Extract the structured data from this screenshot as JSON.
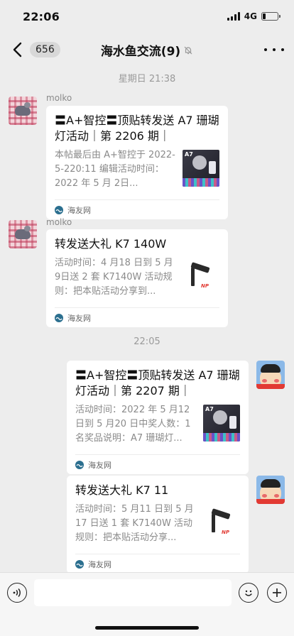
{
  "status_bar": {
    "time": "22:06",
    "network": "4G",
    "battery_level": 0.2
  },
  "nav": {
    "unread_count": "656",
    "title": "海水鱼交流(9)"
  },
  "timestamps": [
    "星期日 21:38",
    "22:05"
  ],
  "messages": [
    {
      "sender": "molko",
      "title": "〓A+智控〓顶贴转发送 A7 珊瑚灯活动｜第 2206 期｜",
      "desc": "本帖最后由 A+智控于 2022-5-220:11 编辑活动时间：2022 年 5 月 2日...",
      "thumb_label": "A7",
      "source": "海友网"
    },
    {
      "sender": "molko",
      "title": "转发送大礼 K7 140W",
      "desc": "活动时间：4 月18 日到 5 月 9日送 2 套 K7140W 活动规则：把本贴活动分享到...",
      "thumb_label": "NP",
      "source": "海友网"
    },
    {
      "sender": "",
      "title": "〓A+智控〓顶贴转发送 A7 珊瑚灯活动｜第 2207 期｜",
      "desc": "活动时间：2022 年 5 月12 日到 5 月20 日中奖人数：1 名奖品说明：A7 珊瑚灯...",
      "thumb_label": "A7",
      "source": "海友网"
    },
    {
      "sender": "",
      "title": "转发送大礼 K7 11",
      "desc": "活动时间：5 月11 日到 5 月17 日送 1 套 K7140W 活动规则：把本贴活动分享...",
      "thumb_label": "NP",
      "source": "海友网"
    }
  ],
  "input": {
    "value": "",
    "placeholder": ""
  },
  "icons": {
    "back": "chevron-left-icon",
    "mute": "bell-off-icon",
    "more": "more-dots-icon",
    "voice": "voice-icon",
    "emoji": "emoji-icon",
    "add": "plus-icon",
    "source": "haiyou-logo-icon"
  },
  "colors": {
    "background": "#ededed",
    "card": "#ffffff",
    "timestamp": "#9a9a9a"
  }
}
